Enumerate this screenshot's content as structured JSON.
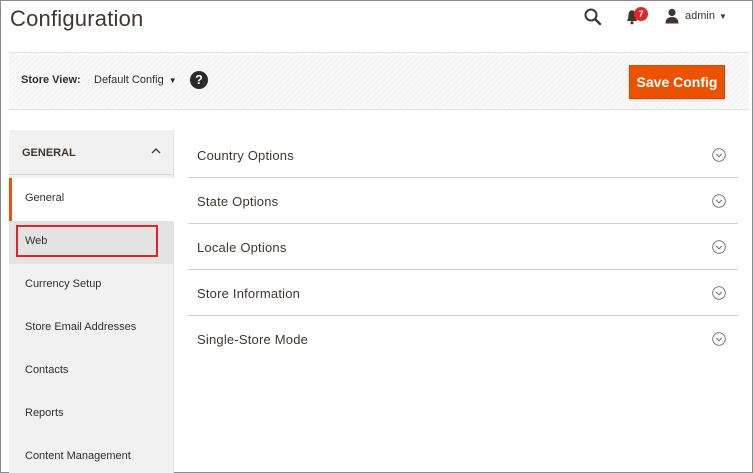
{
  "header": {
    "title": "Configuration",
    "notification_count": "7",
    "user_name": "admin",
    "icons": {
      "search": "search-icon",
      "notifications": "bell-icon",
      "user": "user-icon"
    }
  },
  "store_view": {
    "label": "Store View:",
    "value": "Default Config",
    "help_glyph": "?",
    "save_label": "Save Config",
    "accent": "#eb5202"
  },
  "sidebar": {
    "group_title": "GENERAL",
    "items": [
      {
        "label": "General",
        "state": "active"
      },
      {
        "label": "Web",
        "state": "highlighted"
      },
      {
        "label": "Currency Setup"
      },
      {
        "label": "Store Email Addresses"
      },
      {
        "label": "Contacts"
      },
      {
        "label": "Reports"
      },
      {
        "label": "Content Management"
      }
    ]
  },
  "main": {
    "sections": [
      {
        "title": "Country Options"
      },
      {
        "title": "State Options"
      },
      {
        "title": "Locale Options"
      },
      {
        "title": "Store Information"
      },
      {
        "title": "Single-Store Mode"
      }
    ]
  }
}
